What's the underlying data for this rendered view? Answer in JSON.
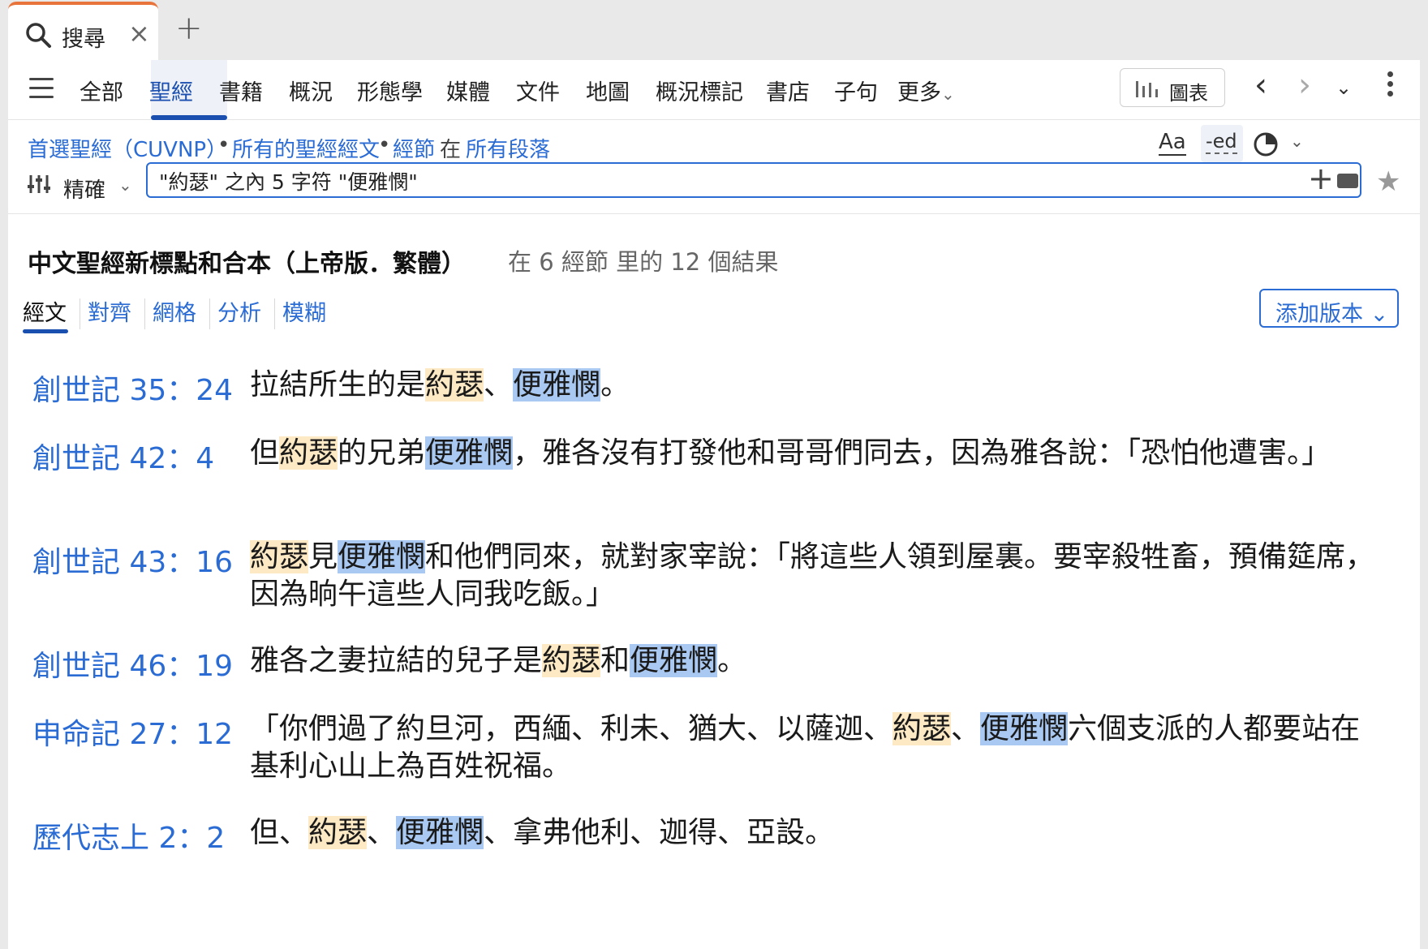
{
  "tab": {
    "label": "搜尋",
    "close": "×",
    "new": "+"
  },
  "nav": {
    "items": [
      "全部",
      "聖經",
      "書籍",
      "概況",
      "形態學",
      "媒體",
      "文件",
      "地圖",
      "概況標記",
      "書店",
      "子句",
      "更多"
    ],
    "active_index": 1,
    "more_chevron": "⌄",
    "chart_label": "圖表",
    "back": "‹",
    "forward": "›",
    "history_chevron": "⌄"
  },
  "crumbs": {
    "preferred_bible": "首選聖經（CUVNP）",
    "all_text": "所有的聖經經文",
    "verse": "經節",
    "in_word": "在",
    "all_passages": "所有段落",
    "dot": "•"
  },
  "tools": {
    "aa": "Aa",
    "ed": "-ed",
    "chevron": "⌄"
  },
  "search": {
    "mode": "精確",
    "mode_chevron": "⌄",
    "query": "\"約瑟\" 之內 5 字符 \"便雅憫\"",
    "plus": "+",
    "star": "★"
  },
  "results": {
    "title": "中文聖經新標點和合本（上帝版．繁體）",
    "count": "在 6 經節 里的 12 個結果"
  },
  "view_tabs": [
    "經文",
    "對齊",
    "網格",
    "分析",
    "模糊"
  ],
  "add_version": "添加版本 ⌄",
  "verses": [
    {
      "ref": "創世記 35：24",
      "parts": [
        [
          "拉結所生的是",
          ""
        ],
        [
          "約瑟",
          "a"
        ],
        [
          "、",
          ""
        ],
        [
          "便雅憫",
          "b"
        ],
        [
          "。",
          ""
        ]
      ]
    },
    {
      "ref": "創世記 42：4",
      "parts": [
        [
          "但",
          ""
        ],
        [
          "約瑟",
          "a"
        ],
        [
          "的兄弟",
          ""
        ],
        [
          "便雅憫",
          "b"
        ],
        [
          "，雅各沒有打發他和哥哥們同去，因為雅各說：「恐怕他遭害。」",
          ""
        ]
      ]
    },
    {
      "ref": "創世記 43：16",
      "parts": [
        [
          "約瑟",
          "a"
        ],
        [
          "見",
          ""
        ],
        [
          "便雅憫",
          "b"
        ],
        [
          "和他們同來，就對家宰說：「將這些人領到屋裏。要宰殺牲畜，預備筵席，因為晌午這些人同我吃飯。」",
          ""
        ]
      ]
    },
    {
      "ref": "創世記 46：19",
      "parts": [
        [
          "雅各之妻拉結的兒子是",
          ""
        ],
        [
          "約瑟",
          "a"
        ],
        [
          "和",
          ""
        ],
        [
          "便雅憫",
          "b"
        ],
        [
          "。",
          ""
        ]
      ]
    },
    {
      "ref": "申命記 27：12",
      "parts": [
        [
          "「你們過了約旦河，西緬、利未、猶大、以薩迦、",
          ""
        ],
        [
          "約瑟",
          "a"
        ],
        [
          "、",
          ""
        ],
        [
          "便雅憫",
          "b"
        ],
        [
          "六個支派的人都要站在基利心山上為百姓祝福。",
          ""
        ]
      ]
    },
    {
      "ref": "歷代志上 2：2",
      "parts": [
        [
          "但、",
          ""
        ],
        [
          "約瑟",
          "a"
        ],
        [
          "、",
          ""
        ],
        [
          "便雅憫",
          "b"
        ],
        [
          "、拿弗他利、迦得、亞設。",
          ""
        ]
      ]
    }
  ],
  "colors": {
    "accent": "#2a6bd4",
    "tab_accent": "#e8743b",
    "highlight_a": "#fde9c4",
    "highlight_b": "#a9c9f2"
  }
}
